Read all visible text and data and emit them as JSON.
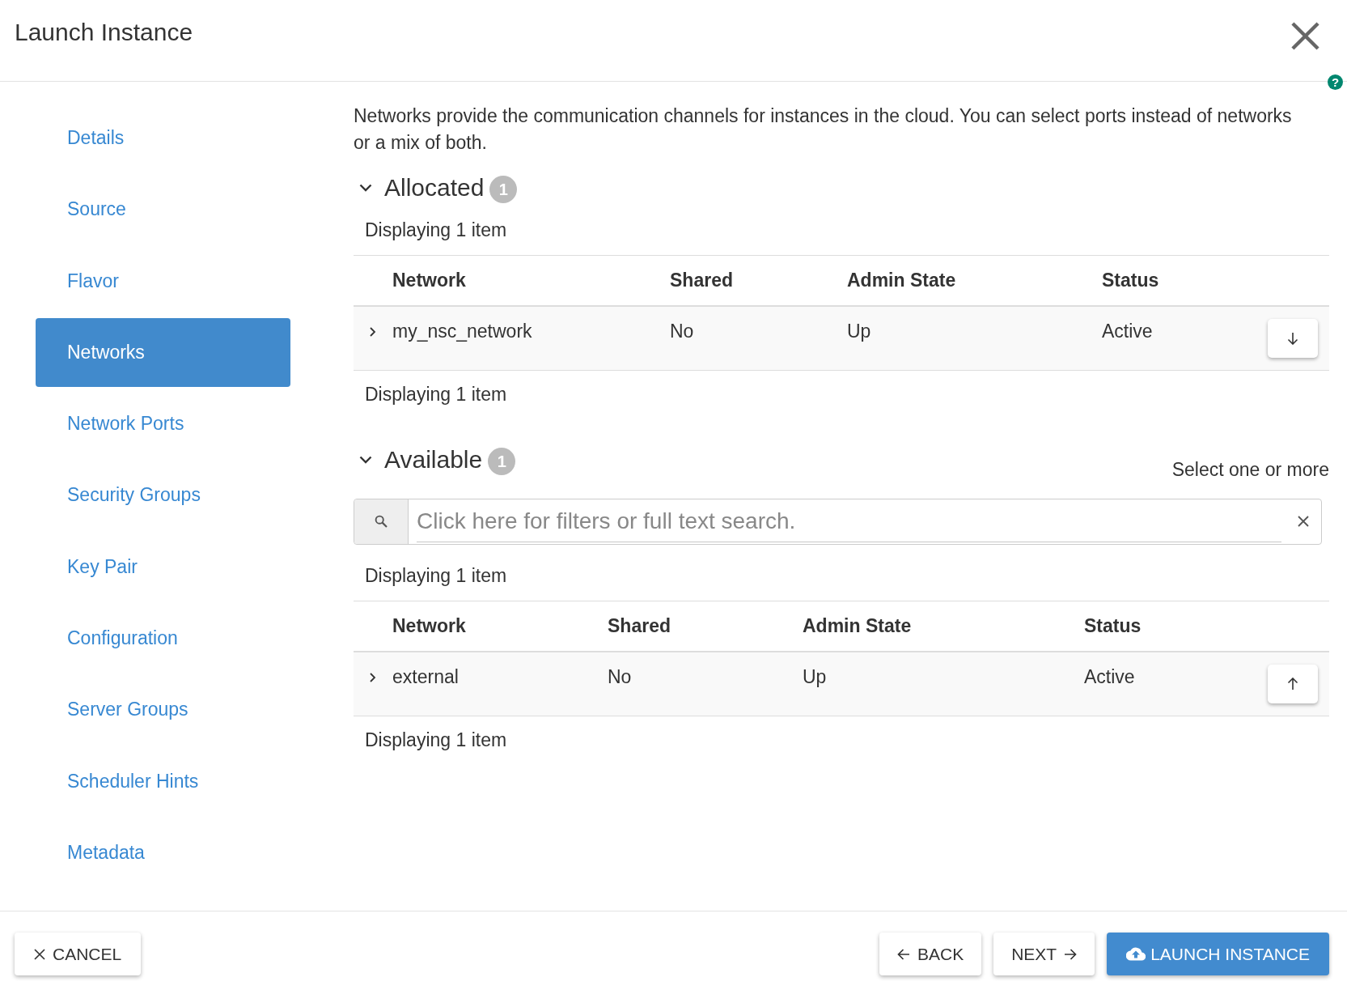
{
  "dialog": {
    "title": "Launch Instance",
    "help": "?"
  },
  "sidebar": {
    "items": [
      {
        "label": "Details",
        "selected": false
      },
      {
        "label": "Source",
        "selected": false
      },
      {
        "label": "Flavor",
        "selected": false
      },
      {
        "label": "Networks",
        "selected": true
      },
      {
        "label": "Network Ports",
        "selected": false
      },
      {
        "label": "Security Groups",
        "selected": false
      },
      {
        "label": "Key Pair",
        "selected": false
      },
      {
        "label": "Configuration",
        "selected": false
      },
      {
        "label": "Server Groups",
        "selected": false
      },
      {
        "label": "Scheduler Hints",
        "selected": false
      },
      {
        "label": "Metadata",
        "selected": false
      }
    ]
  },
  "content": {
    "description": "Networks provide the communication channels for instances in the cloud. You can select ports instead of networks or a mix of both.",
    "sections": [
      {
        "kind": "allocated",
        "title": "Allocated",
        "count": "1",
        "expanded": true,
        "summary_top": "Displaying 1 item",
        "columns": [
          "Network",
          "Shared",
          "Admin State",
          "Status"
        ],
        "rows": [
          {
            "expanded": false,
            "cells": [
              "my_nsc_network",
              "No",
              "Up",
              "Active"
            ]
          }
        ],
        "summary_bottom": "Displaying 1 item"
      },
      {
        "kind": "available",
        "title": "Available",
        "count": "1",
        "expanded": true,
        "hint": "Select one or more",
        "search": {
          "placeholder": "Click here for filters or full text search."
        },
        "summary_top": "Displaying 1 item",
        "columns": [
          "Network",
          "Shared",
          "Admin State",
          "Status"
        ],
        "rows": [
          {
            "expanded": false,
            "cells": [
              "external",
              "No",
              "Up",
              "Active"
            ]
          }
        ],
        "summary_bottom": "Displaying 1 item"
      }
    ]
  },
  "footer": {
    "buttons": [
      {
        "kind": "cancel",
        "label": "CANCEL"
      },
      {
        "kind": "back",
        "label": "BACK"
      },
      {
        "kind": "next",
        "label": "NEXT"
      },
      {
        "kind": "launch",
        "label": "LAUNCH INSTANCE"
      }
    ]
  }
}
